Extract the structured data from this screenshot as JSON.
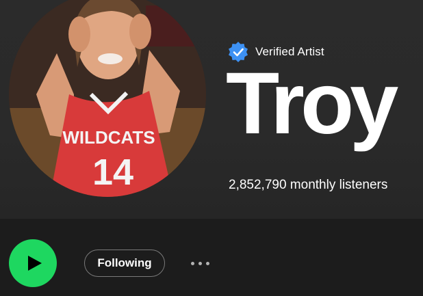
{
  "artist": {
    "verified_label": "Verified Artist",
    "name": "Troy",
    "monthly_listeners": "2,852,790 monthly listeners",
    "photo": {
      "jersey_text": "WILDCATS",
      "jersey_number": "14"
    }
  },
  "actions": {
    "play_icon": "play-icon",
    "follow_label": "Following",
    "more_icon": "more-horizontal-icon"
  },
  "colors": {
    "accent_green": "#1ed760",
    "verified_blue": "#3d91f4",
    "background": "#212121",
    "jersey_red": "#d83a3a"
  }
}
